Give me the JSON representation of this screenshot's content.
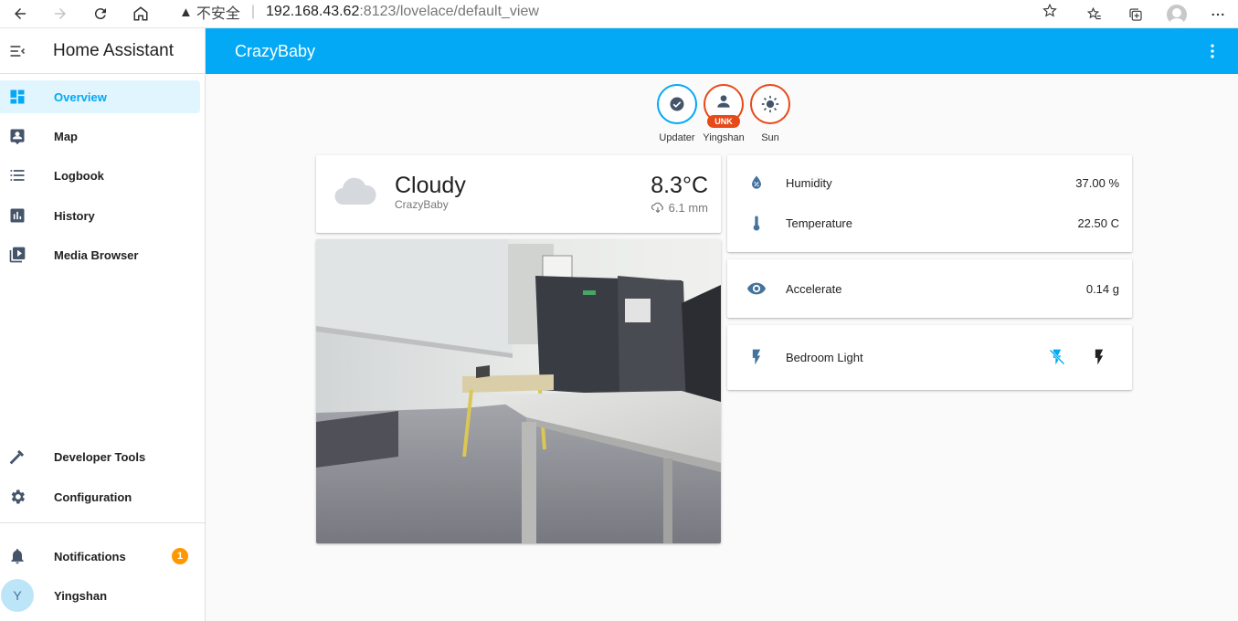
{
  "browser": {
    "insecure_label": "不安全",
    "url_host": "192.168.43.62",
    "url_path": ":8123/lovelace/default_view"
  },
  "sidebar": {
    "title": "Home Assistant",
    "items": [
      {
        "label": "Overview",
        "icon": "dashboard-icon"
      },
      {
        "label": "Map",
        "icon": "map-account-icon"
      },
      {
        "label": "Logbook",
        "icon": "list-icon"
      },
      {
        "label": "History",
        "icon": "chart-box-icon"
      },
      {
        "label": "Media Browser",
        "icon": "play-box-multiple-icon"
      }
    ],
    "bottom_items": [
      {
        "label": "Developer Tools",
        "icon": "hammer-icon"
      },
      {
        "label": "Configuration",
        "icon": "cog-icon"
      }
    ],
    "notifications": {
      "label": "Notifications",
      "count": "1"
    },
    "user": {
      "name": "Yingshan",
      "initial": "Y"
    }
  },
  "appbar": {
    "title": "CrazyBaby"
  },
  "badges": [
    {
      "name": "Updater",
      "icon": "check-circle-icon",
      "color": "#03a9f4"
    },
    {
      "name": "Yingshan",
      "icon": "account-icon",
      "label": "UNK",
      "color": "#e64a19"
    },
    {
      "name": "Sun",
      "icon": "sun-icon",
      "color": "#e64a19"
    }
  ],
  "weather": {
    "condition": "Cloudy",
    "name": "CrazyBaby",
    "temperature": "8.3°C",
    "precipitation": "6.1 mm"
  },
  "sensors": [
    {
      "label": "Humidity",
      "value": "37.00 %",
      "icon": "water-percent-icon"
    },
    {
      "label": "Temperature",
      "value": "22.50 C",
      "icon": "thermometer-icon"
    }
  ],
  "accelerate": {
    "label": "Accelerate",
    "value": "0.14 g",
    "icon": "eye-icon"
  },
  "light": {
    "label": "Bedroom Light",
    "icon": "flash-icon"
  }
}
